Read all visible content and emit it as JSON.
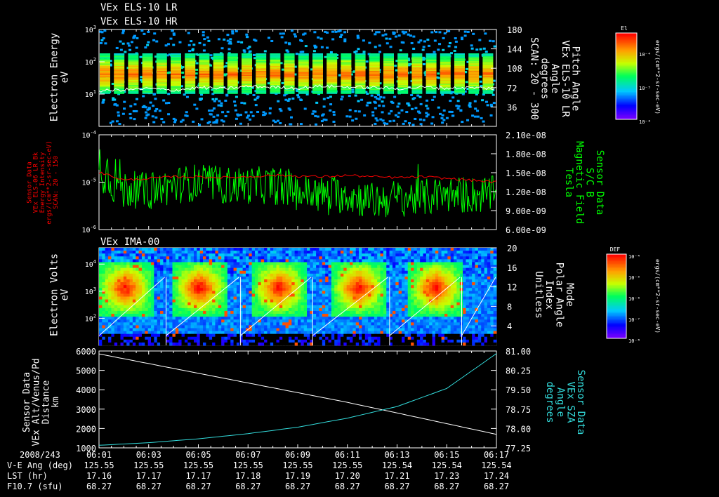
{
  "chart_data": [
    {
      "type": "heatmap",
      "titles": [
        "VEx ELS-10 LR",
        "VEx ELS-10 HR"
      ],
      "ylabel": [
        "Electron Energy",
        "eV"
      ],
      "y_scale": "log",
      "ylim": [
        1,
        1000
      ],
      "y_ticks": [
        {
          "v": 1000,
          "base": "10",
          "exp": "3"
        },
        {
          "v": 100,
          "base": "10",
          "exp": "2"
        },
        {
          "v": 10,
          "base": "10",
          "exp": "1"
        }
      ],
      "y2label": [
        "Pitch Angle",
        "VEx ELS-10 LR",
        "Angle",
        "degrees",
        "SCAN: 20 - 300"
      ],
      "y2lim": [
        0,
        180
      ],
      "y2_ticks": [
        "180",
        "144",
        "108",
        "72",
        "36"
      ],
      "colorbar": {
        "label": "El",
        "units": "ergs/(cm**2-sr-sec-eV)",
        "ticks": [
          "10⁻⁴",
          "10⁻⁵",
          "10⁻⁶"
        ]
      },
      "line_series": {
        "color": "#ffffff",
        "axis": "right",
        "x_minutes": [
          0,
          1,
          2,
          3,
          4,
          5,
          6,
          7,
          8,
          9,
          10,
          11,
          12,
          13,
          14,
          15,
          16
        ],
        "values": [
          66,
          68,
          70,
          67,
          72,
          70,
          74,
          73,
          71,
          75,
          73,
          72,
          70,
          73,
          71,
          72,
          70
        ]
      }
    },
    {
      "type": "line",
      "ylabel": [
        "Sensor Data",
        "VEx ELS-06 LR Bk",
        "Energy Intensity",
        "ergs/(cm**2-sr-sec-eV)",
        "SCAN: 20 - 150"
      ],
      "ylabel_color": "#ff0000",
      "y_scale": "log",
      "ylim": [
        1e-06,
        0.0001
      ],
      "y_ticks": [
        {
          "v": 0.0001,
          "base": "10",
          "exp": "-4"
        },
        {
          "v": 1e-05,
          "base": "10",
          "exp": "-5"
        },
        {
          "v": 1e-06,
          "base": "10",
          "exp": "-6"
        }
      ],
      "y2label": [
        "Sensor Data",
        "S/C B",
        "Magnetic Field",
        "Tesla"
      ],
      "y2label_color": "#00ff00",
      "y2lim": [
        6e-09,
        2.1e-08
      ],
      "y2_ticks": [
        {
          "v": 2.1e-08,
          "label": "2.10e-08"
        },
        {
          "v": 1.8e-08,
          "label": "1.80e-08"
        },
        {
          "v": 1.5e-08,
          "label": "1.50e-08"
        },
        {
          "v": 1.2e-08,
          "label": "1.20e-08"
        },
        {
          "v": 9e-09,
          "label": "9.00e-09"
        },
        {
          "v": 6e-09,
          "label": "6.00e-09"
        }
      ],
      "series": [
        {
          "axis": "left",
          "color": "#ff0000",
          "x_minutes": [
            0,
            1,
            2,
            3,
            4,
            5,
            6,
            7,
            8,
            9,
            10,
            11,
            12,
            13,
            14,
            15,
            16
          ],
          "values": [
            1.6e-05,
            1.1e-05,
            1.2e-05,
            1.3e-05,
            1.3e-05,
            1.25e-05,
            1.3e-05,
            1.4e-05,
            1.35e-05,
            1.3e-05,
            1.4e-05,
            1.3e-05,
            1.25e-05,
            1.3e-05,
            1.2e-05,
            1.1e-05,
            1e-05
          ]
        },
        {
          "axis": "right",
          "color": "#00ff00",
          "x_minutes": [
            0,
            1,
            2,
            3,
            4,
            5,
            6,
            7,
            8,
            9,
            10,
            11,
            12,
            13,
            14,
            15,
            16
          ],
          "values": [
            1.65e-08,
            1.25e-08,
            1.2e-08,
            1.3e-08,
            1.35e-08,
            1.3e-08,
            1.3e-08,
            1.3e-08,
            1.2e-08,
            1.15e-08,
            1.15e-08,
            1.05e-08,
            1.1e-08,
            1.1e-08,
            1.15e-08,
            1.15e-08,
            1.15e-08
          ]
        }
      ]
    },
    {
      "type": "heatmap",
      "titles": [
        "VEx IMA-00"
      ],
      "ylabel": [
        "Electron Volts",
        "eV"
      ],
      "y_scale": "log",
      "ylim": [
        10,
        40000
      ],
      "y_ticks": [
        {
          "v": 10000,
          "base": "10",
          "exp": "4"
        },
        {
          "v": 1000,
          "base": "10",
          "exp": "3"
        },
        {
          "v": 100,
          "base": "10",
          "exp": "2"
        }
      ],
      "y2label": [
        "Mode",
        "Polar Angle",
        "Index",
        "Unitless"
      ],
      "y2lim": [
        0,
        20
      ],
      "y2_ticks": [
        "20",
        "16",
        "12",
        "8",
        "4"
      ],
      "colorbar": {
        "label": "DEF",
        "units": "ergs/(cm**2-sr-sec-eV)",
        "ticks": [
          "10⁻⁴",
          "10⁻⁵",
          "10⁻⁶",
          "10⁻⁷",
          "10⁻⁸"
        ]
      },
      "hotspot_minutes": [
        1.0,
        4.0,
        7.2,
        10.4,
        13.5
      ],
      "scan_start_minutes": [
        0.0,
        2.7,
        5.7,
        8.6,
        11.7,
        14.6
      ]
    },
    {
      "type": "line",
      "ylabel": [
        "Sensor Data",
        "VEx Alt/Venus/Pd",
        "Distance",
        "km"
      ],
      "ylim": [
        1000,
        6000
      ],
      "y_ticks": [
        "6000",
        "5000",
        "4000",
        "3000",
        "2000",
        "1000"
      ],
      "y2label": [
        "Sensor Data",
        "VEx SZA",
        "Angle",
        "degrees"
      ],
      "y2label_color": "#33dddd",
      "y2lim": [
        77.25,
        81.0
      ],
      "y2_ticks": [
        "81.00",
        "80.25",
        "79.50",
        "78.75",
        "78.00",
        "77.25"
      ],
      "series": [
        {
          "axis": "left",
          "color": "#ffffff",
          "x_minutes": [
            0,
            2,
            4,
            6,
            8,
            10,
            12,
            14,
            16
          ],
          "values": [
            5850,
            5350,
            4850,
            4350,
            3850,
            3350,
            2800,
            2250,
            1700
          ]
        },
        {
          "axis": "right",
          "color": "#33dddd",
          "x_minutes": [
            0,
            2,
            4,
            6,
            8,
            10,
            12,
            14,
            16
          ],
          "values": [
            77.35,
            77.45,
            77.6,
            77.8,
            78.05,
            78.4,
            78.85,
            79.55,
            80.9
          ]
        }
      ]
    }
  ],
  "x_axis": {
    "date_label": "2008/243",
    "ticks": [
      "06:01",
      "06:03",
      "06:05",
      "06:07",
      "06:09",
      "06:11",
      "06:13",
      "06:15",
      "06:17"
    ],
    "rows": [
      {
        "label": "V-E Ang (deg)",
        "values": [
          "125.55",
          "125.55",
          "125.55",
          "125.55",
          "125.55",
          "125.55",
          "125.54",
          "125.54",
          "125.54"
        ]
      },
      {
        "label": "LST (hr)",
        "values": [
          "17.16",
          "17.17",
          "17.17",
          "17.18",
          "17.19",
          "17.20",
          "17.21",
          "17.23",
          "17.24"
        ]
      },
      {
        "label": "F10.7 (sfu)",
        "values": [
          "68.27",
          "68.27",
          "68.27",
          "68.27",
          "68.27",
          "68.27",
          "68.27",
          "68.27",
          "68.27"
        ]
      }
    ]
  }
}
